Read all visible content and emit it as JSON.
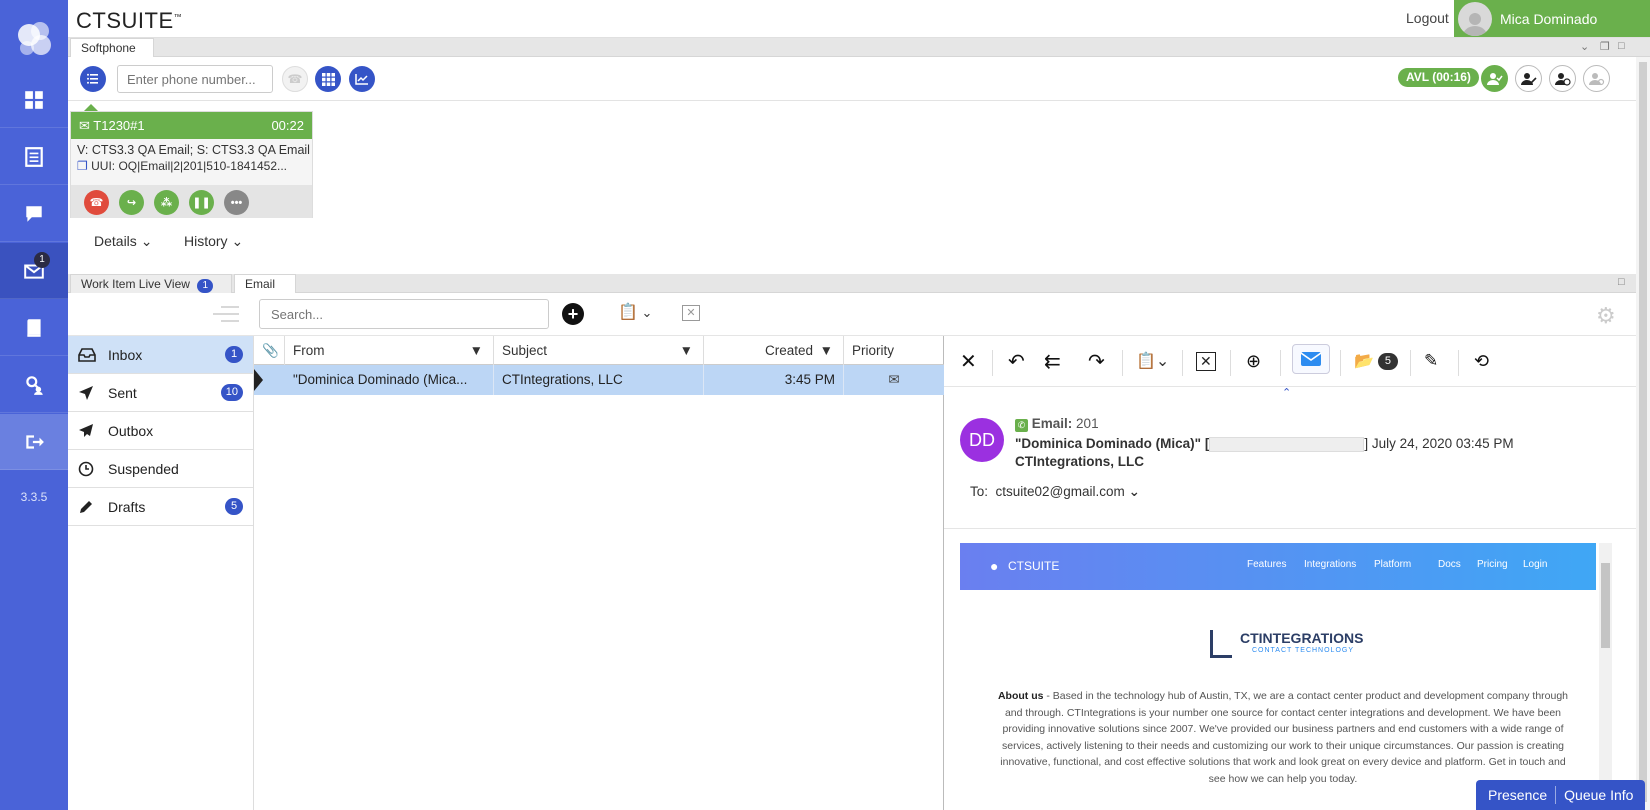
{
  "sidebar": {
    "version": "3.3.5",
    "email_badge": "1",
    "items": [
      "dashboard-icon",
      "list-icon",
      "chat-icon",
      "email-icon",
      "book-icon",
      "contacts-icon",
      "logout-icon"
    ]
  },
  "header": {
    "brand": "CTSUITE",
    "brand_mark": "™",
    "logout": "Logout",
    "user_name": "Mica Dominado"
  },
  "softphone": {
    "tab": "Softphone",
    "phone_placeholder": "Enter phone number...",
    "status": "AVL (00:16)"
  },
  "call": {
    "id": "T1230#1",
    "timer": "00:22",
    "line1": "V: CTS3.3 QA Email; S: CTS3.3 QA Email",
    "line2": "UUI: OQ|Email|2|201|510-1841452..."
  },
  "details_tabs": [
    "Details",
    "History"
  ],
  "panel_tabs": {
    "live_view": "Work Item Live View",
    "live_view_badge": "1",
    "email": "Email"
  },
  "email": {
    "search_placeholder": "Search...",
    "folders": [
      {
        "label": "Inbox",
        "badge": "1"
      },
      {
        "label": "Sent",
        "badge": "10"
      },
      {
        "label": "Outbox",
        "badge": ""
      },
      {
        "label": "Suspended",
        "badge": ""
      },
      {
        "label": "Drafts",
        "badge": "5"
      }
    ],
    "columns": {
      "from": "From",
      "subject": "Subject",
      "created": "Created",
      "priority": "Priority"
    },
    "rows": [
      {
        "from": "\"Dominica Dominado (Mica...",
        "subject": "CTIntegrations, LLC",
        "created": "3:45 PM"
      }
    ]
  },
  "reader": {
    "folder_count": "5",
    "initials": "DD",
    "email_label": "Email:",
    "email_id": "201",
    "sender": "\"Dominica Dominado (Mica)\" [",
    "sender_tail": "] July 24, 2020 03:45 PM",
    "company": "CTIntegrations, LLC",
    "to_label": "To:",
    "to": "ctsuite02@gmail.com",
    "preview": {
      "brand": "CTSUITE",
      "nav": [
        "Features",
        "Integrations",
        "Platform",
        "Docs",
        "Pricing",
        "Login"
      ],
      "logo_title": "CTINTEGRATIONS",
      "logo_sub": "CONTACT TECHNOLOGY",
      "about_label": "About us",
      "about_text": " - Based in the technology hub of Austin, TX, we are a contact center product and development company through and through. CTIntegrations is your number one source for contact center integrations and development. We have been providing innovative solutions since 2007. We've provided our business partners and end customers with a wide range of services, actively listening to their needs and customizing our work to their unique circumstances. Our passion is creating innovative, functional, and cost effective solutions that work and look great on every device and platform. Get in touch and see how we can help you today."
    }
  },
  "footer": {
    "presence": "Presence",
    "queue": "Queue Info"
  },
  "colors": {
    "brand_blue": "#4a63d8",
    "accent_blue": "#3554c7",
    "green": "#6ab04c",
    "avatar_purple": "#9b30e0",
    "selected_row": "#bcd6f5"
  }
}
